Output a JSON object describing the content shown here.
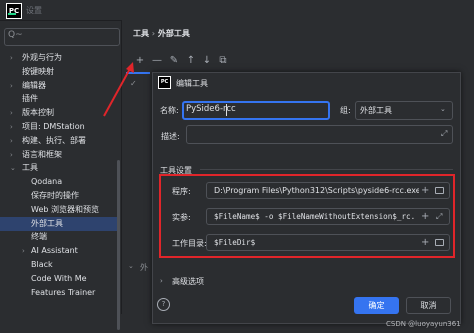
{
  "window": {
    "title": "设置",
    "logo": "PC"
  },
  "sidebar": {
    "search_placeholder": "Q~",
    "items": [
      {
        "label": "外观与行为",
        "arrow": "›",
        "indent": 0
      },
      {
        "label": "按键映射",
        "arrow": "",
        "indent": 0
      },
      {
        "label": "编辑器",
        "arrow": "›",
        "indent": 0
      },
      {
        "label": "插件",
        "arrow": "",
        "indent": 0
      },
      {
        "label": "版本控制",
        "arrow": "›",
        "indent": 0
      },
      {
        "label": "项目: DMStation",
        "arrow": "›",
        "indent": 0
      },
      {
        "label": "构建、执行、部署",
        "arrow": "›",
        "indent": 0
      },
      {
        "label": "语言和框架",
        "arrow": "›",
        "indent": 0
      },
      {
        "label": "工具",
        "arrow": "⌄",
        "indent": 0
      },
      {
        "label": "Qodana",
        "arrow": "",
        "indent": 1
      },
      {
        "label": "保存时的操作",
        "arrow": "",
        "indent": 1
      },
      {
        "label": "Web 浏览器和预览",
        "arrow": "",
        "indent": 1
      },
      {
        "label": "外部工具",
        "arrow": "",
        "indent": 1,
        "selected": true
      },
      {
        "label": "终端",
        "arrow": "",
        "indent": 1
      },
      {
        "label": "AI Assistant",
        "arrow": "›",
        "indent": 1
      },
      {
        "label": "Black",
        "arrow": "",
        "indent": 1
      },
      {
        "label": "Code With Me",
        "arrow": "",
        "indent": 1
      },
      {
        "label": "Features Trainer",
        "arrow": "",
        "indent": 1
      }
    ]
  },
  "breadcrumb": {
    "parent": "工具",
    "sep": "›",
    "current": "外部工具"
  },
  "toolbar": {
    "add": "+",
    "remove": "—",
    "edit": "✎",
    "up": "↑",
    "down": "↓",
    "copy": "⧉"
  },
  "background": {
    "check": "✓",
    "row": "外"
  },
  "dialog": {
    "logo": "PC",
    "title": "编辑工具",
    "name_label": "名称:",
    "name_value": "PySide6-rcc",
    "group_label": "组:",
    "group_value": "外部工具",
    "description_label": "描述:",
    "tool_settings_title": "工具设置",
    "program_label": "程序:",
    "program_value": "D:\\Program Files\\Python312\\Scripts\\pyside6-rcc.exe",
    "args_label": "实参:",
    "args_value": "$FileName$ -o $FileNameWithoutExtension$_rc.py",
    "workdir_label": "工作目录:",
    "workdir_value": "$FileDir$",
    "advanced_label": "高级选项",
    "help": "?",
    "ok_label": "确定",
    "cancel_label": "取消"
  },
  "watermark": "CSDN @luoyayun361",
  "colors": {
    "accent": "#3574f0",
    "highlight_box": "#e0252a",
    "selected_row": "#2e436e"
  }
}
